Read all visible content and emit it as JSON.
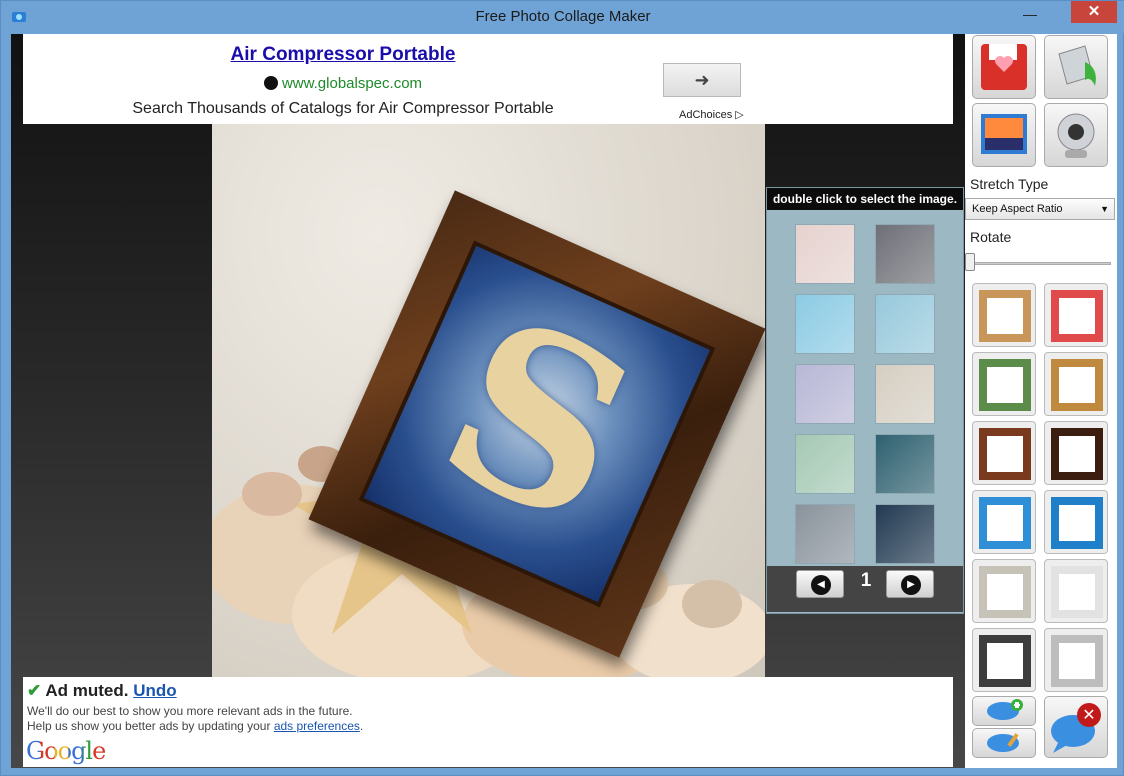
{
  "window": {
    "title": "Free Photo Collage Maker",
    "minimize": "—",
    "close": "✕"
  },
  "ad_top": {
    "title": "Air Compressor Portable",
    "url": "www.globalspec.com",
    "description": "Search Thousands of Catalogs for Air Compressor Portable",
    "arrow": "➜",
    "choices": "AdChoices ▷"
  },
  "background_panel": {
    "header": "double click to select the image.",
    "page": "1",
    "thumbs": [
      {
        "name": "pink-paper",
        "color": "#e6d2cf"
      },
      {
        "name": "ornate-silver",
        "color": "#6f6f78"
      },
      {
        "name": "blue-water",
        "color": "#8ccbe4"
      },
      {
        "name": "ocean-sky",
        "color": "#97c9dc"
      },
      {
        "name": "bubbles-lilac",
        "color": "#b8b7d6"
      },
      {
        "name": "sand-shells",
        "color": "#d5cec2"
      },
      {
        "name": "pastel-rings",
        "color": "#a5c9b4"
      },
      {
        "name": "moonlit-shore",
        "color": "#2f6170"
      },
      {
        "name": "silver-wave",
        "color": "#8a939c"
      },
      {
        "name": "night-seascape",
        "color": "#223a52"
      }
    ]
  },
  "ad_bottom": {
    "check": "✔",
    "muted": "Ad muted.",
    "undo": "Undo",
    "line1": "We'll do our best to show you more relevant ads in the future.",
    "line2_prefix": "Help us show you better ads by updating your ",
    "line2_link": "ads preferences",
    "line2_suffix": ".",
    "google": "Google"
  },
  "right_panel": {
    "stretch_label": "Stretch Type",
    "stretch_value": "Keep Aspect Ratio",
    "rotate_label": "Rotate",
    "rotate_value": 0,
    "frames": [
      {
        "name": "frame-plain-wood",
        "color": "#c9965a"
      },
      {
        "name": "frame-hearts",
        "color": "#e04a4a"
      },
      {
        "name": "frame-green-lace",
        "color": "#5b8c4a"
      },
      {
        "name": "frame-gold",
        "color": "#c08a3e"
      },
      {
        "name": "frame-dark-wood",
        "color": "#7a3a1d"
      },
      {
        "name": "frame-ebony",
        "color": "#3b1e10"
      },
      {
        "name": "frame-blue-pattern",
        "color": "#2f8fd6"
      },
      {
        "name": "frame-floral-blue",
        "color": "#1f7fc9"
      },
      {
        "name": "frame-stitched",
        "color": "#c6c2b8"
      },
      {
        "name": "frame-puzzle",
        "color": "#e2e2e2"
      },
      {
        "name": "frame-tiles",
        "color": "#3d3d3d"
      },
      {
        "name": "frame-grey",
        "color": "#bdbdbd"
      }
    ]
  }
}
